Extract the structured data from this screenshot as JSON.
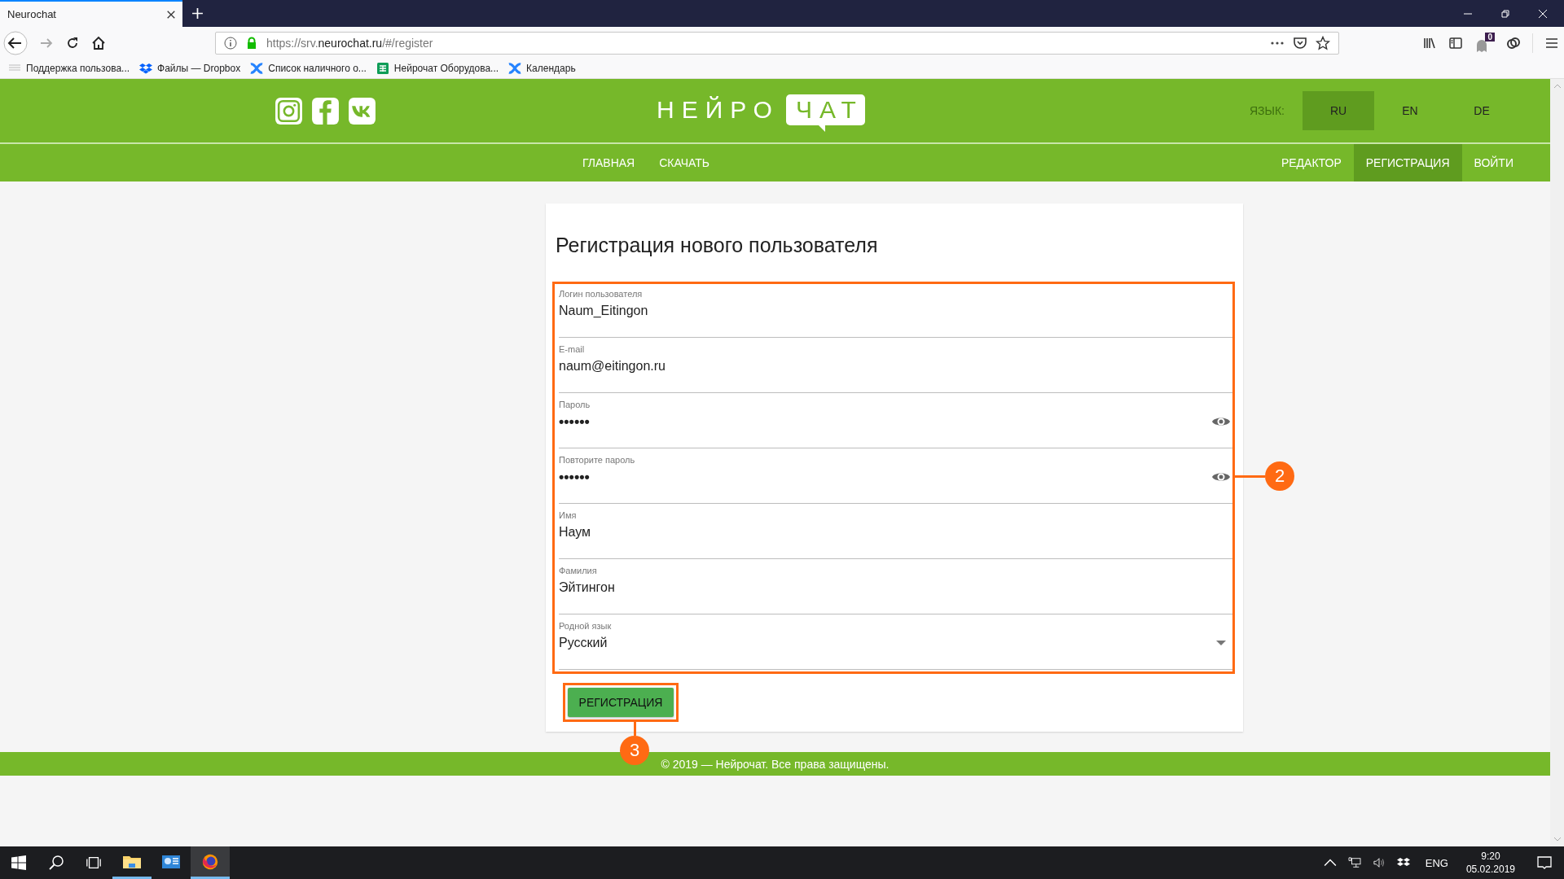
{
  "browser": {
    "tab_title": "Neurochat",
    "url_prefix": "https://srv.",
    "url_host": "neurochat.ru",
    "url_path": "/#/register",
    "extension_badge": "0",
    "bookmarks": [
      {
        "kind": "page",
        "label": "Поддержка пользова..."
      },
      {
        "kind": "dropbox",
        "label": "Файлы — Dropbox"
      },
      {
        "kind": "confluence",
        "label": "Список наличного о..."
      },
      {
        "kind": "sheet",
        "label": "Нейрочат Оборудова..."
      },
      {
        "kind": "confluence",
        "label": "Календарь"
      }
    ]
  },
  "header": {
    "logo_left": "НЕЙРО",
    "logo_right": "ЧАТ",
    "language_label": "ЯЗЫК:",
    "languages": [
      {
        "label": "RU",
        "selected": true
      },
      {
        "label": "EN",
        "selected": false
      },
      {
        "label": "DE",
        "selected": false
      }
    ]
  },
  "nav": {
    "left": [
      {
        "label": "ГЛАВНАЯ",
        "selected": false
      },
      {
        "label": "СКАЧАТЬ",
        "selected": false
      }
    ],
    "right": [
      {
        "label": "РЕДАКТОР",
        "selected": false
      },
      {
        "label": "РЕГИСТРАЦИЯ",
        "selected": true
      },
      {
        "label": "ВОЙТИ",
        "selected": false
      }
    ]
  },
  "form": {
    "title": "Регистрация нового пользователя",
    "fields": [
      {
        "kind": "text",
        "label": "Логин пользователя",
        "value": "Naum_Eitingon"
      },
      {
        "kind": "text",
        "label": "E-mail",
        "value": "naum@eitingon.ru"
      },
      {
        "kind": "password",
        "label": "Пароль",
        "value": "••••••"
      },
      {
        "kind": "password",
        "label": "Повторите пароль",
        "value": "••••••"
      },
      {
        "kind": "text",
        "label": "Имя",
        "value": "Наум"
      },
      {
        "kind": "text",
        "label": "Фамилия",
        "value": "Эйтингон"
      },
      {
        "kind": "select",
        "label": "Родной язык",
        "value": "Русский"
      }
    ],
    "submit": "РЕГИСТРАЦИЯ",
    "fields_callout": "2",
    "submit_callout": "3"
  },
  "footer": "© 2019 — Нейрочат. Все права защищены.",
  "taskbar": {
    "apps": [
      {
        "kind": "explorer",
        "running": true,
        "selected": false
      },
      {
        "kind": "control",
        "running": false,
        "selected": false
      },
      {
        "kind": "firefox",
        "running": true,
        "selected": true
      }
    ],
    "language": "ENG",
    "time": "9:20",
    "date": "05.02.2019"
  }
}
